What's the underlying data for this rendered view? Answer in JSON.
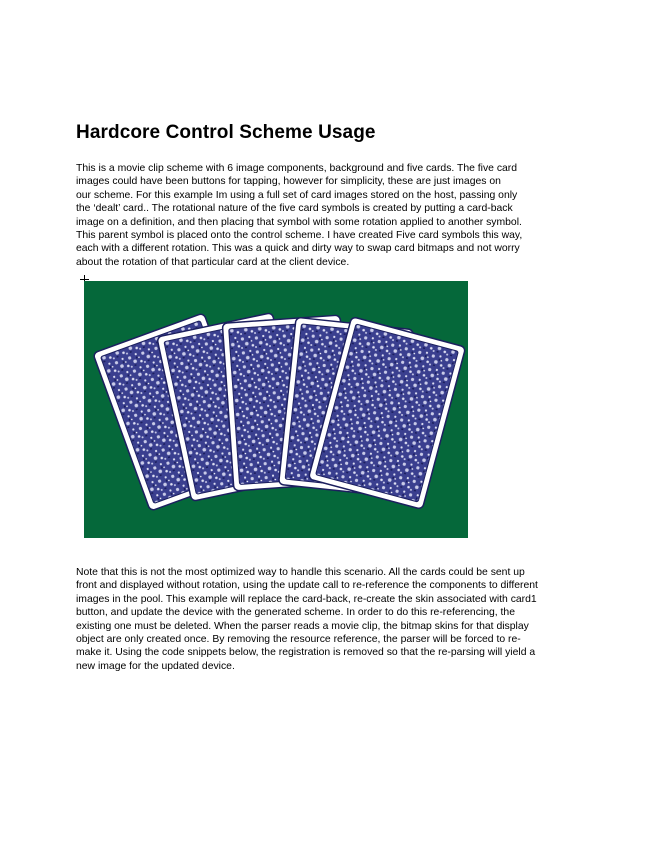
{
  "heading": "Hardcore Control Scheme Usage",
  "paragraph_1": [
    "This is a movie clip scheme with 6 image components, background and five cards. The five card",
    "images could have been buttons for tapping, however for simplicity, these are just images on",
    "our scheme. For this example Im using a full set of card images stored on the host, passing only",
    "the ‘dealt’ card.. The rotational nature of the five card symbols is created by putting a card-back",
    "image on a definition, and then placing that symbol with some rotation applied to another symbol.",
    "This parent symbol is placed onto the control scheme. I have created Five card symbols this way,",
    "each with a different rotation. This was a quick and dirty way to swap card bitmaps and not worry",
    "about the rotation of that particular card at the client device."
  ],
  "paragraph_2": [
    "Note that this is not the most optimized way to handle this scenario. All the cards could be sent up",
    "front and displayed without rotation, using the update call to re-reference the components to different",
    "images in the pool. This example will replace the card-back, re-create the skin associated with card1",
    "button, and update the device with the generated scheme. In order to do this re-referencing, the",
    "existing one must be deleted. When the parser reads a movie clip, the bitmap skins for that display",
    "object are only created once. By removing the resource reference, the parser will be forced to re-",
    "make it. Using the code snippets below, the registration is removed so that the re-parsing will yield a",
    "new image for the updated device."
  ],
  "figure": {
    "background_color": "#05683a",
    "card_back_color": "#3a3f8f",
    "card_pattern_color": "#c9cbe8",
    "card_border_color": "#ffffff",
    "card_count": 5
  }
}
